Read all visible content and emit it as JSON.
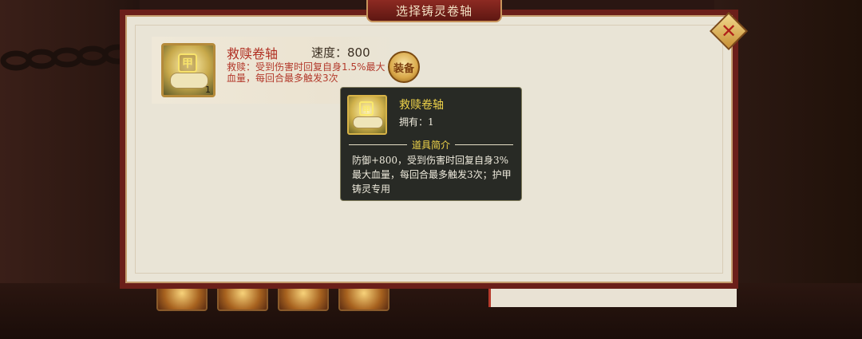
{
  "dialog": {
    "title": "选择铸灵卷轴",
    "close_label": "✕"
  },
  "item_card": {
    "name": "救赎卷轴",
    "speed": "速度：800",
    "description": "救赎：受到伤害时回复自身1.5%最大血量，每回合最多触发3次",
    "count": "1",
    "equip_button_label": "装备",
    "icon_glyph": "甲"
  },
  "tooltip": {
    "name": "救赎卷轴",
    "owned": "拥有：1",
    "section_title": "道具简介",
    "description": "防御+800，受到伤害时回复自身3%最大血量，每回合最多触发3次；护甲铸灵专用",
    "icon_glyph": "甲"
  },
  "colors": {
    "panel_border": "#6b1f1a",
    "item_name": "#b02f22",
    "tooltip_title": "#f1d54a"
  },
  "icons": [
    "close-icon",
    "scroll-icon",
    "equip-icon"
  ]
}
